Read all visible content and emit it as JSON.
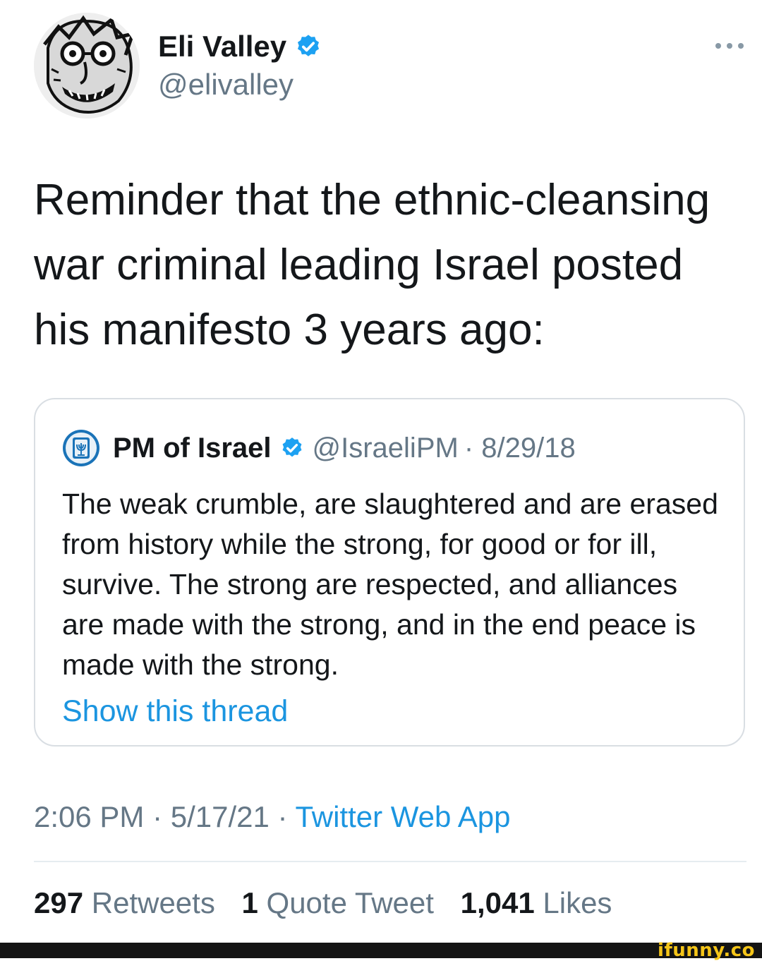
{
  "tweet": {
    "author": {
      "name": "Eli Valley",
      "handle": "@elivalley",
      "verified": true
    },
    "text": "Reminder that the ethnic-cleansing war criminal leading Israel posted his manifesto 3 years ago:",
    "quote": {
      "author": {
        "name": "PM of Israel",
        "handle": "@IsraeliPM",
        "verified": true
      },
      "date": "· 8/29/18",
      "text": "The weak crumble, are slaughtered and are erased from history while the strong, for good or for ill, survive. The strong are respected, and alliances are made with the strong, and in the end peace is made with the strong.",
      "link_text": "Show this thread"
    },
    "meta": {
      "time_date": "2:06 PM · 5/17/21 · ",
      "source": "Twitter Web App"
    },
    "stats": [
      {
        "count": "297",
        "label": "Retweets"
      },
      {
        "count": "1",
        "label": "Quote Tweet"
      },
      {
        "count": "1,041",
        "label": "Likes"
      }
    ]
  },
  "icons": {
    "verified": "verified-badge-icon",
    "more": "more-options-icon",
    "quote_avatar": "israel-emblem-icon"
  },
  "colors": {
    "link": "#1b95e0",
    "verified": "#1da1f2",
    "secondary_text": "#657786",
    "watermark": "#f5c518"
  },
  "watermark": "ifunny.co"
}
